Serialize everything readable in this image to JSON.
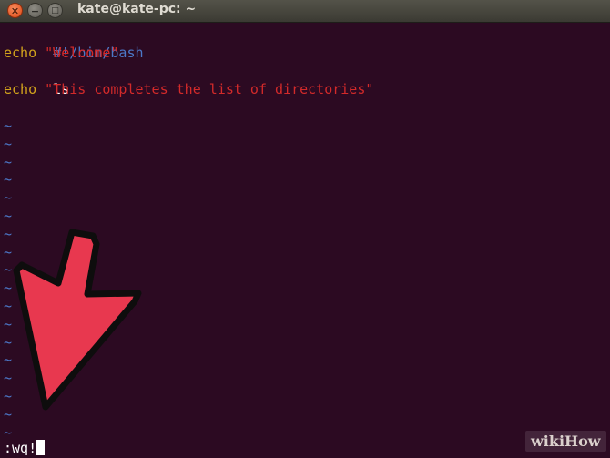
{
  "window": {
    "title": "kate@kate-pc: ~",
    "close_glyph": "✕",
    "minimize_glyph": "−",
    "maximize_glyph": "□"
  },
  "editor": {
    "shebang": "#!/bin/bash",
    "line2_keyword": "echo",
    "line2_string": "\"Welcome\"",
    "line3": "ls",
    "line4_keyword": "echo",
    "line4_string": "\"This completes the list of directories\"",
    "tilde": "~",
    "command": ":wq!"
  },
  "watermark": "wikiHow",
  "colors": {
    "background": "#2c0a22",
    "comment": "#4c78c8",
    "keyword": "#d2a31c",
    "string": "#d32a2a",
    "arrow": "#e8384f"
  }
}
